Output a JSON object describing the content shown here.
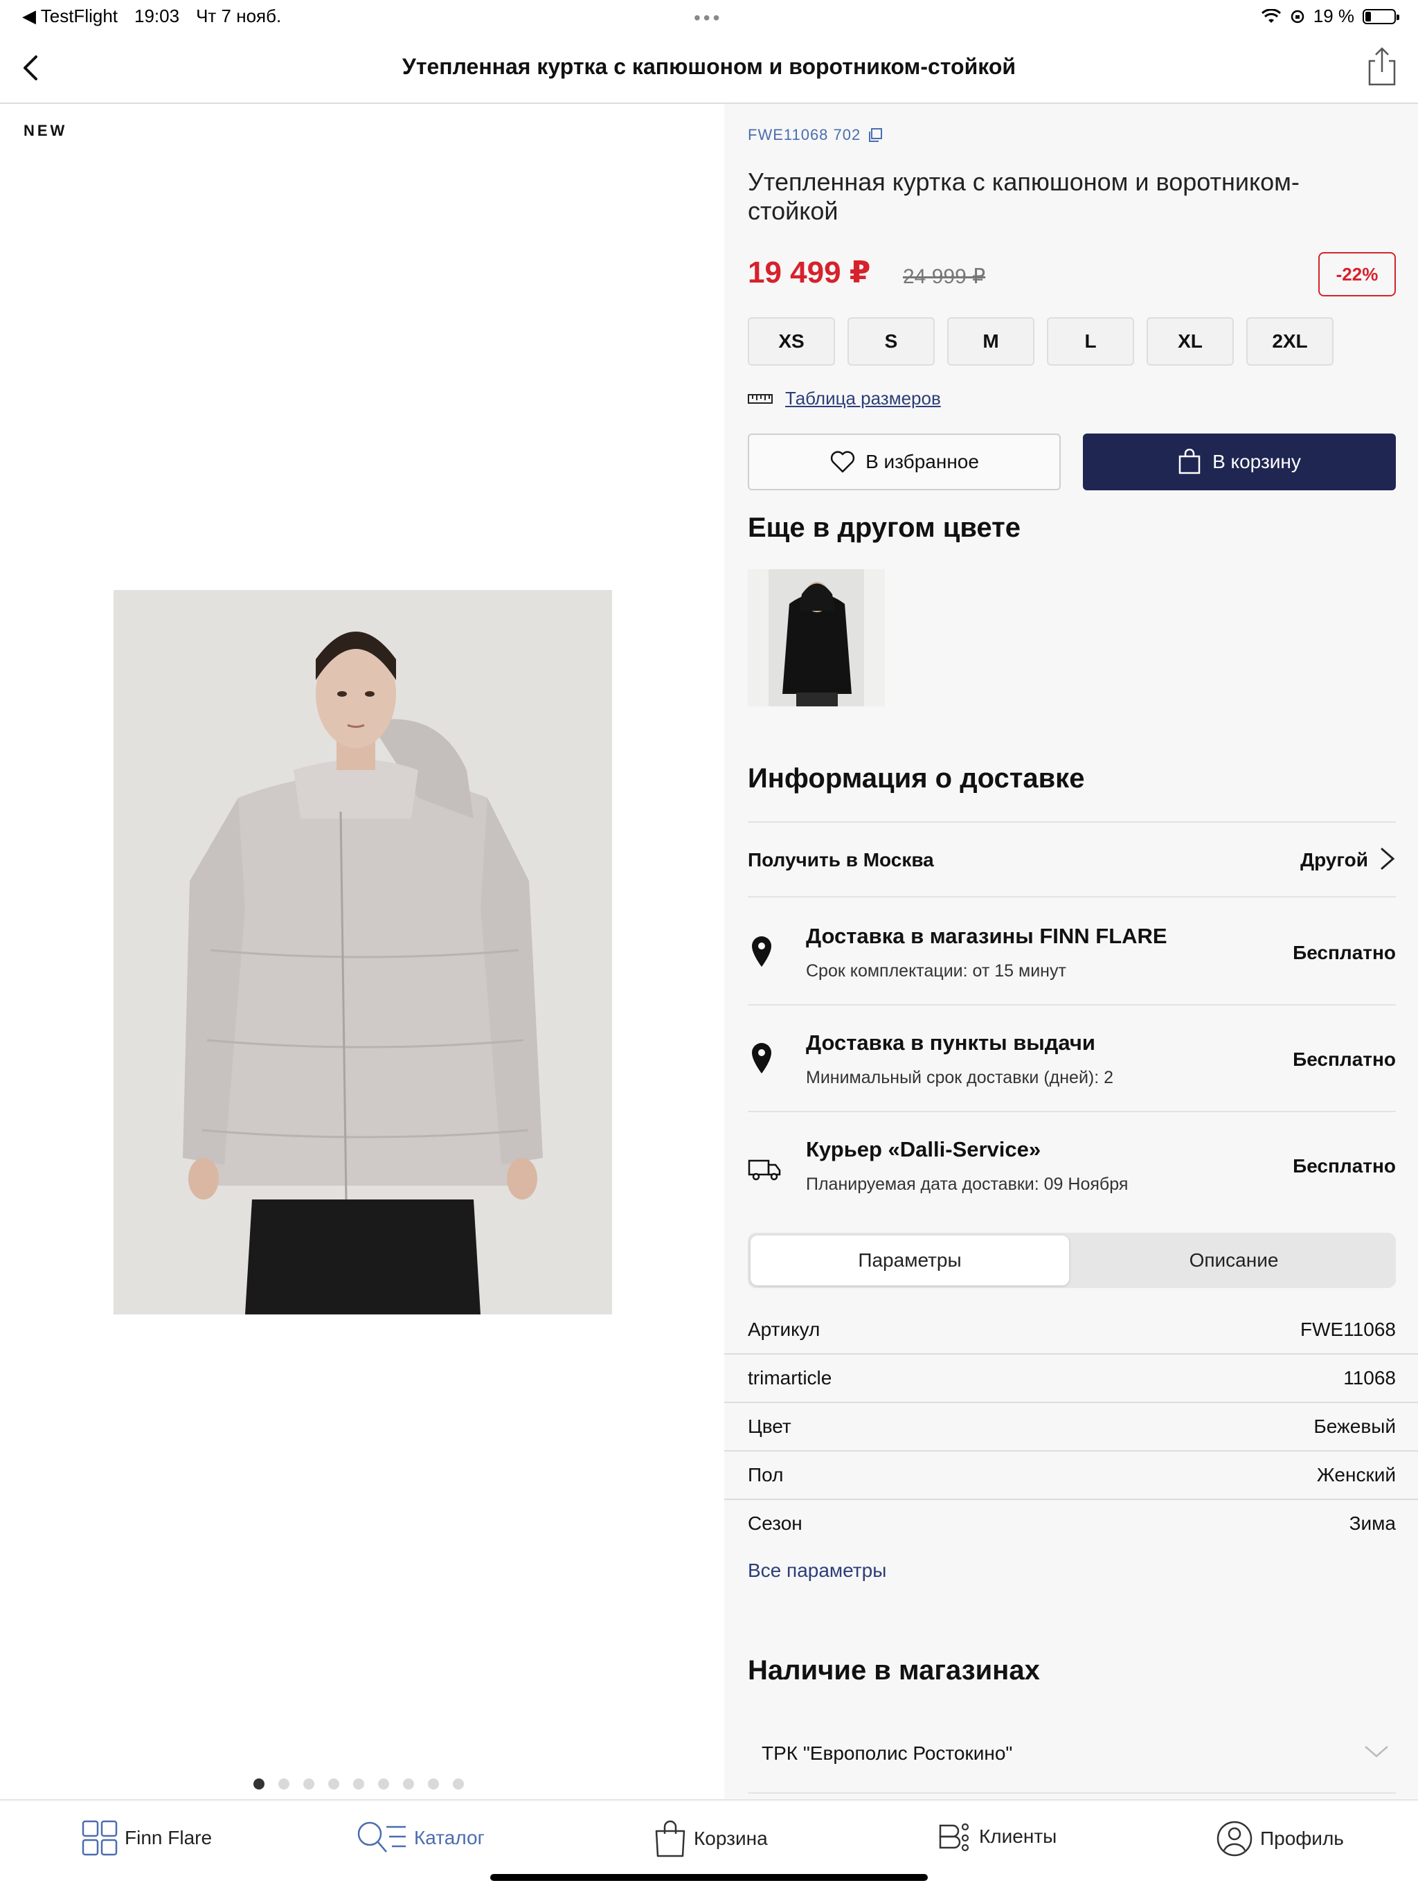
{
  "status_bar": {
    "back_app": "◀ TestFlight",
    "time": "19:03",
    "date": "Чт 7 нояб.",
    "battery_text": "19 %",
    "battery_level": 0.19
  },
  "nav": {
    "title": "Утепленная куртка с капюшоном и воротником-стойкой"
  },
  "gallery": {
    "badge": "NEW",
    "pages_total": 9,
    "active_page": 1
  },
  "product": {
    "sku": "FWE11068 702",
    "title": "Утепленная куртка с капюшоном и воротником-стойкой",
    "price_now": "19 499 ₽",
    "price_old": "24 999 ₽",
    "discount": "-22%",
    "sizes": [
      "XS",
      "S",
      "M",
      "L",
      "XL",
      "2XL"
    ],
    "size_table_link": "Таблица размеров",
    "favorite_label": "В избранное",
    "cart_label": "В корзину",
    "other_color_title": "Еще в другом цвете"
  },
  "delivery": {
    "title": "Информация о доставке",
    "pickup_label": "Получить в Москва",
    "pickup_other": "Другой",
    "options": [
      {
        "title": "Доставка в магазины FINN FLARE",
        "subtitle": "Срок комплектации: от 15 минут",
        "price": "Бесплатно",
        "icon": "location-pin-icon"
      },
      {
        "title": "Доставка в пункты выдачи",
        "subtitle": "Минимальный срок доставки (дней): 2",
        "price": "Бесплатно",
        "icon": "location-pin-icon"
      },
      {
        "title": "Курьер «Dalli-Service»",
        "subtitle": "Планируемая дата доставки: 09 Ноября",
        "price": "Бесплатно",
        "icon": "truck-icon"
      }
    ]
  },
  "tabs": {
    "params_label": "Параметры",
    "description_label": "Описание"
  },
  "params": [
    {
      "key": "Артикул",
      "value": "FWE11068"
    },
    {
      "key": "trimarticle",
      "value": "11068"
    },
    {
      "key": "Цвет",
      "value": "Бежевый"
    },
    {
      "key": "Пол",
      "value": "Женский"
    },
    {
      "key": "Сезон",
      "value": "Зима"
    }
  ],
  "all_params_link": "Все параметры",
  "stores": {
    "title": "Наличие в магазинах",
    "first_store": "ТРК \"Европолис Ростокино\""
  },
  "tab_bar": [
    {
      "label": "Finn Flare",
      "icon": "grid-icon"
    },
    {
      "label": "Каталог",
      "icon": "catalog-search-icon"
    },
    {
      "label": "Корзина",
      "icon": "bag-icon"
    },
    {
      "label": "Клиенты",
      "icon": "clients-icon"
    },
    {
      "label": "Профиль",
      "icon": "profile-icon"
    }
  ],
  "colors": {
    "accent_red": "#d6222c",
    "primary_navy": "#1f2651",
    "link_blue": "#4a6db0"
  }
}
